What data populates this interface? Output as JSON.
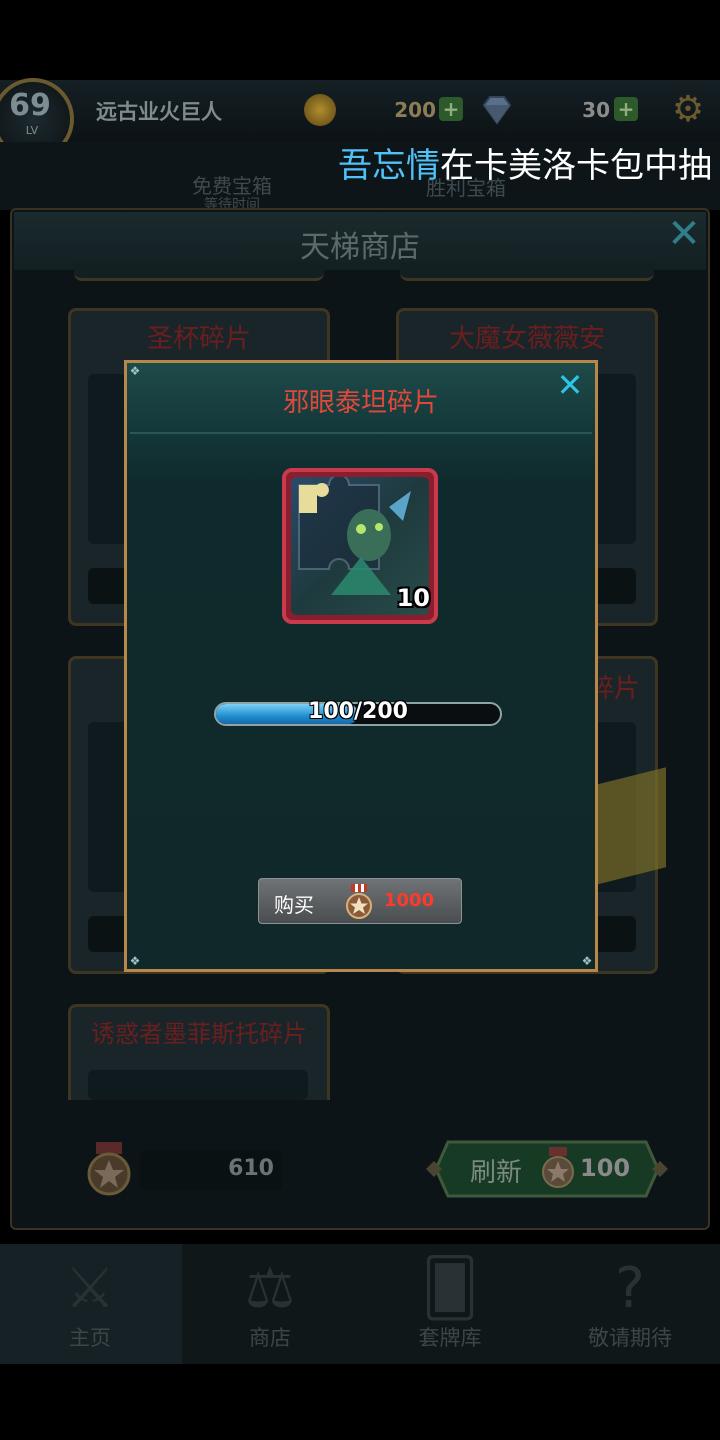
{
  "player": {
    "level": "69",
    "level_caption": "LV",
    "name": "远古业火巨人"
  },
  "currency": {
    "coins": "200",
    "gems": "30",
    "plus": "+"
  },
  "ticker": {
    "player": "吾忘情",
    "message": "在卡美洛卡包中抽"
  },
  "background_labels": {
    "free_chest": "免费宝箱",
    "free_chest_sub": "等待时间",
    "victory_chest": "胜利宝箱"
  },
  "shop": {
    "title": "天梯商店",
    "close": "✕",
    "cards": [
      {
        "label": "圣杯碎片"
      },
      {
        "label": "大魔女薇薇安"
      },
      {
        "label": ""
      },
      {
        "label": "碎片"
      },
      {
        "label": "诱惑者墨菲斯托碎片"
      }
    ],
    "honor_points": "610",
    "refresh_label": "刷新",
    "refresh_cost": "100"
  },
  "modal": {
    "title": "邪眼泰坦碎片",
    "close": "✕",
    "item_count": "10",
    "progress_text": "100/200",
    "progress_fraction": 0.5,
    "buy_label": "购买",
    "buy_cost": "1000"
  },
  "nav": {
    "items": [
      {
        "label": "主页",
        "icon": "swords-icon"
      },
      {
        "label": "商店",
        "icon": "scales-icon"
      },
      {
        "label": "套牌库",
        "icon": "cards-icon"
      },
      {
        "label": "敬请期待",
        "icon": "question-icon"
      }
    ]
  },
  "colors": {
    "modal_title": "#e0483a",
    "ticker_player": "#4fc3f7",
    "progress_fill": "#1f8fd0",
    "cost_red": "#ff3a2a"
  }
}
